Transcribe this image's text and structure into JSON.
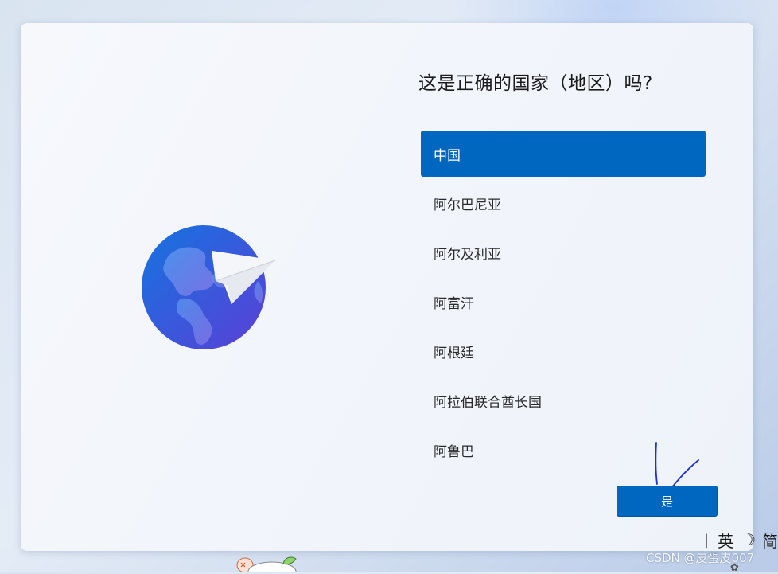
{
  "oobe": {
    "title": "这是正确的国家（地区）吗?",
    "countries": [
      {
        "label": "中国",
        "selected": true
      },
      {
        "label": "阿尔巴尼亚",
        "selected": false
      },
      {
        "label": "阿尔及利亚",
        "selected": false
      },
      {
        "label": "阿富汗",
        "selected": false
      },
      {
        "label": "阿根廷",
        "selected": false
      },
      {
        "label": "阿拉伯联合酋长国",
        "selected": false
      },
      {
        "label": "阿鲁巴",
        "selected": false
      }
    ],
    "confirm_label": "是"
  },
  "ime": {
    "language": "英",
    "mode_icon": "moon-icon",
    "truncated_label": "简"
  },
  "watermark": "CSDN @皮蛋皮007",
  "colors": {
    "accent": "#0067c0",
    "annotation_ink": "#1f2fd0"
  }
}
